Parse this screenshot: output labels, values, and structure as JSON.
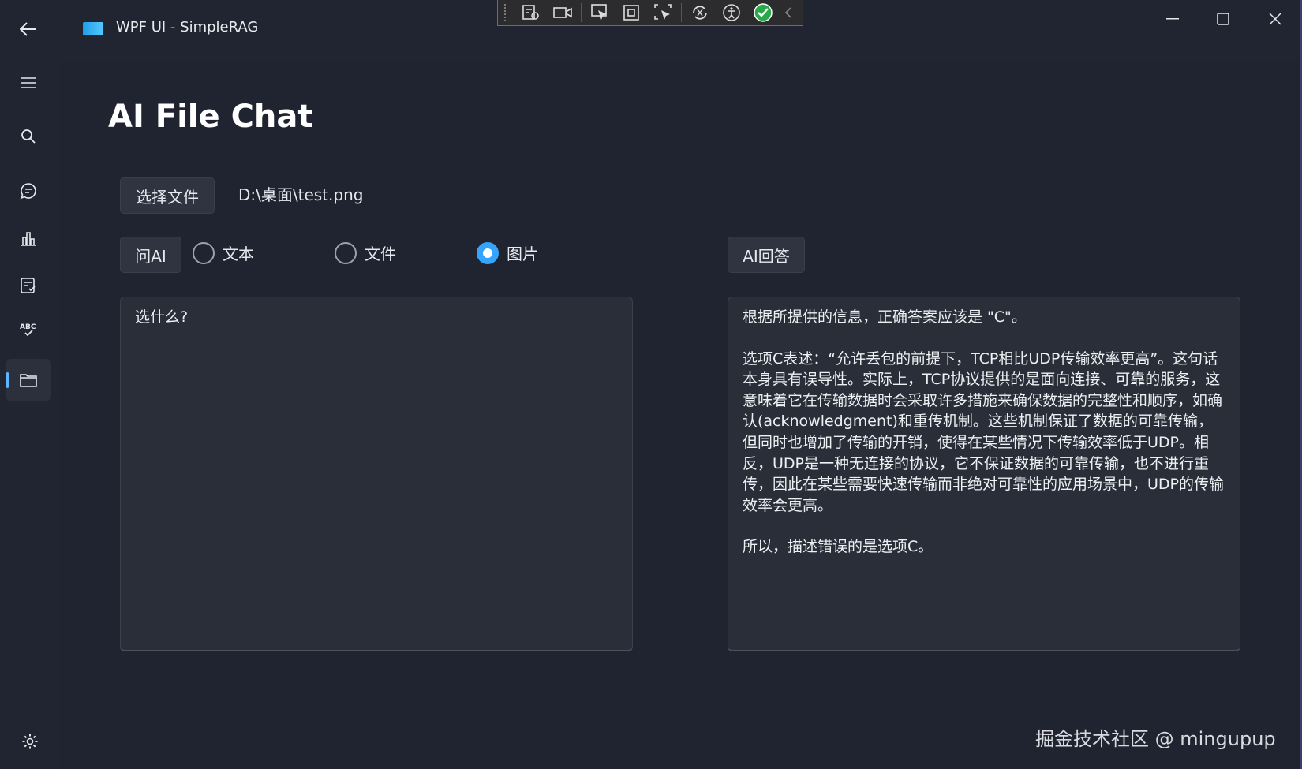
{
  "window": {
    "title": "WPF UI - SimpleRAG",
    "accent": "#35a4ff"
  },
  "debug_toolbar": {
    "icons": [
      "live-visual-tree-icon",
      "record-icon",
      "select-element-icon",
      "display-layout-adorners-icon",
      "track-focus-icon",
      "hot-reload-icon",
      "accessibility-icon",
      "check-icon",
      "collapse-icon"
    ]
  },
  "sidebar": {
    "items": [
      {
        "icon": "hamburger-menu-icon"
      },
      {
        "icon": "search-icon"
      },
      {
        "icon": "chat-icon"
      },
      {
        "icon": "bar-chart-icon"
      },
      {
        "icon": "task-list-icon"
      },
      {
        "icon": "spellcheck-icon"
      },
      {
        "icon": "folder-icon",
        "active": true
      }
    ],
    "settings_icon": "gear-icon"
  },
  "page": {
    "title": "AI File Chat",
    "select_file_label": "选择文件",
    "file_path": "D:\\桌面\\test.png",
    "ask_ai_label": "问AI",
    "radio_options": [
      {
        "label": "文本",
        "checked": false
      },
      {
        "label": "文件",
        "checked": false
      },
      {
        "label": "图片",
        "checked": true
      }
    ],
    "ai_answer_label": "AI回答",
    "question_text": "选什么?",
    "answer_paragraphs": [
      "根据所提供的信息，正确答案应该是 \"C\"。",
      "选项C表述：“允许丢包的前提下，TCP相比UDP传输效率更高”。这句话本身具有误导性。实际上，TCP协议提供的是面向连接、可靠的服务，这意味着它在传输数据时会采取许多措施来确保数据的完整性和顺序，如确认(acknowledgment)和重传机制。这些机制保证了数据的可靠传输，但同时也增加了传输的开销，使得在某些情况下传输效率低于UDP。相反，UDP是一种无连接的协议，它不保证数据的可靠传输，也不进行重传，因此在某些需要快速传输而非绝对可靠性的应用场景中，UDP的传输效率会更高。",
      "所以，描述错误的是选项C。"
    ]
  },
  "watermark": "掘金技术社区 @ mingupup"
}
